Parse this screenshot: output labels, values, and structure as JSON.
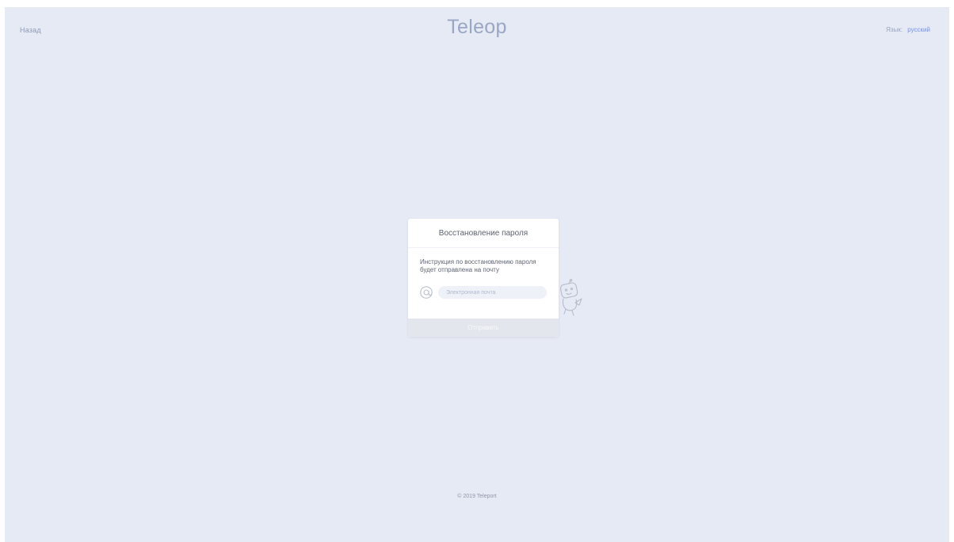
{
  "header": {
    "back_label": "Назад",
    "brand": "Teleop",
    "language_label": "Язык:",
    "language_value": "русский"
  },
  "recovery_card": {
    "title": "Восстановление пароля",
    "description": "Инструкция по восстановлению пароля будет отправлена на почту",
    "email_placeholder": "Электронная почта",
    "email_value": "",
    "submit_label": "Отправить"
  },
  "footer": {
    "copyright": "© 2019 Teleport"
  },
  "icons": {
    "email": "at-sign-icon",
    "mascot": "robot-mascot-icon"
  },
  "colors": {
    "page_background": "#e6eaf4",
    "brand": "#9aa7c4",
    "link_accent": "#7d94d9",
    "card_background": "#ffffff",
    "button_disabled": "#e3e6ec"
  }
}
